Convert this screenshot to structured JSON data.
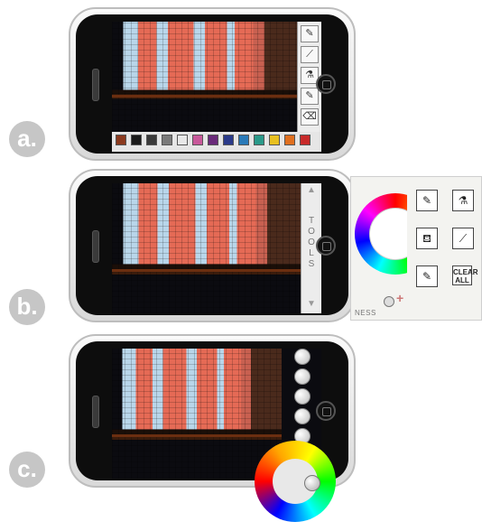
{
  "labels": {
    "a": "a.",
    "b": "b.",
    "c": "c."
  },
  "tools_vertical": [
    "T",
    "O",
    "O",
    "L",
    "S"
  ],
  "panel": {
    "clear_all_line1": "CLEAR",
    "clear_all_line2": "ALL",
    "brightness_label": "NESS",
    "plus_symbol": "+"
  },
  "palette_colors": [
    "#8b3a1e",
    "#1a1a1a",
    "#3a3a3a",
    "#7a7a7a",
    "#e8e8e8",
    "#c8589a",
    "#6a2a7a",
    "#2a3a8a",
    "#2a7ab8",
    "#2a9a8a",
    "#e8c020",
    "#e07020",
    "#c82a2a"
  ],
  "icons": {
    "pencil": "✎",
    "spray": "⚗",
    "bucket": "⛾",
    "brush": "🖌",
    "eraser": "⌫",
    "eyedropper": "⟋"
  }
}
